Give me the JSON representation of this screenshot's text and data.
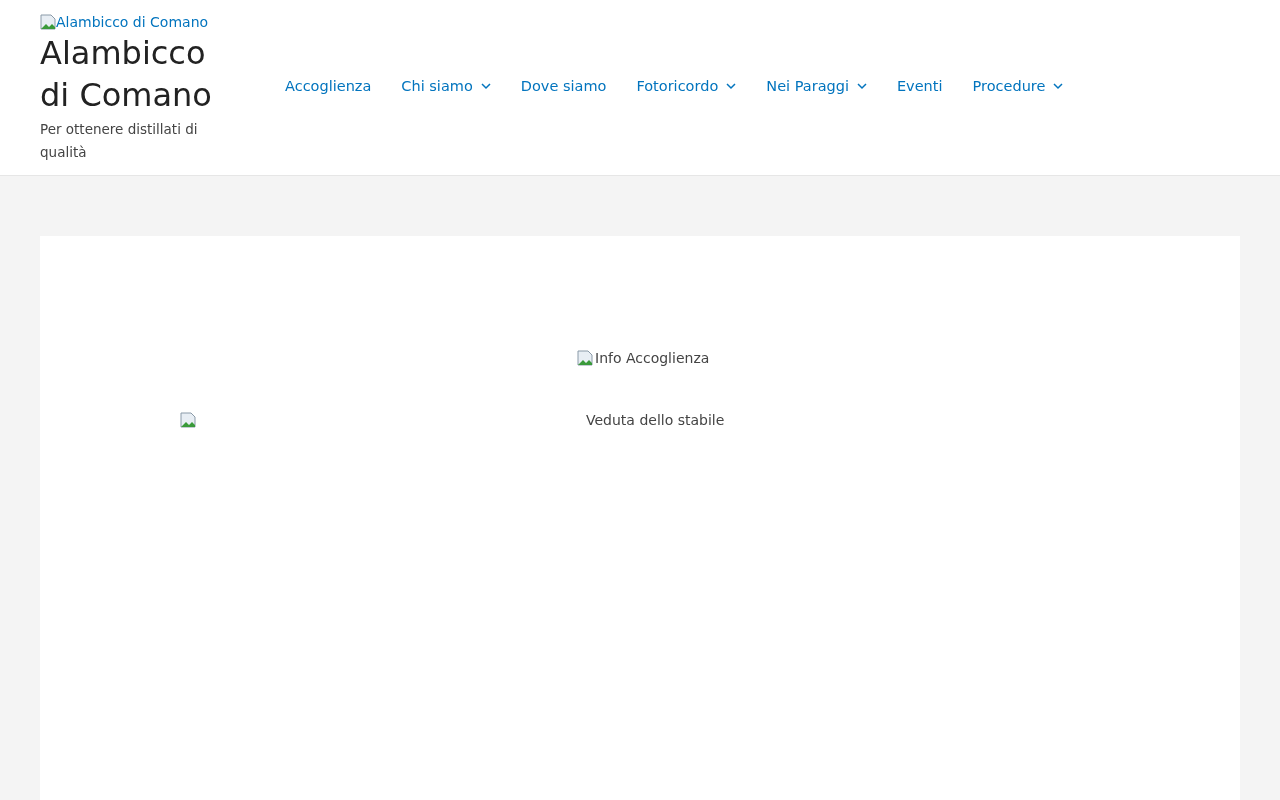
{
  "header": {
    "logo_alt": "Alambicco di Comano",
    "site_title": "Alambicco di Comano",
    "tagline": "Per ottenere distillati di qualità"
  },
  "nav": [
    {
      "label": "Accoglienza",
      "dropdown": false
    },
    {
      "label": "Chi siamo",
      "dropdown": true
    },
    {
      "label": "Dove siamo",
      "dropdown": false
    },
    {
      "label": "Fotoricordo",
      "dropdown": true
    },
    {
      "label": "Nei Paraggi",
      "dropdown": true
    },
    {
      "label": "Eventi",
      "dropdown": false
    },
    {
      "label": "Procedure",
      "dropdown": true
    }
  ],
  "content": {
    "image_alt_1": "Info Accoglienza",
    "image_alt_2": "Veduta dello stabile"
  }
}
